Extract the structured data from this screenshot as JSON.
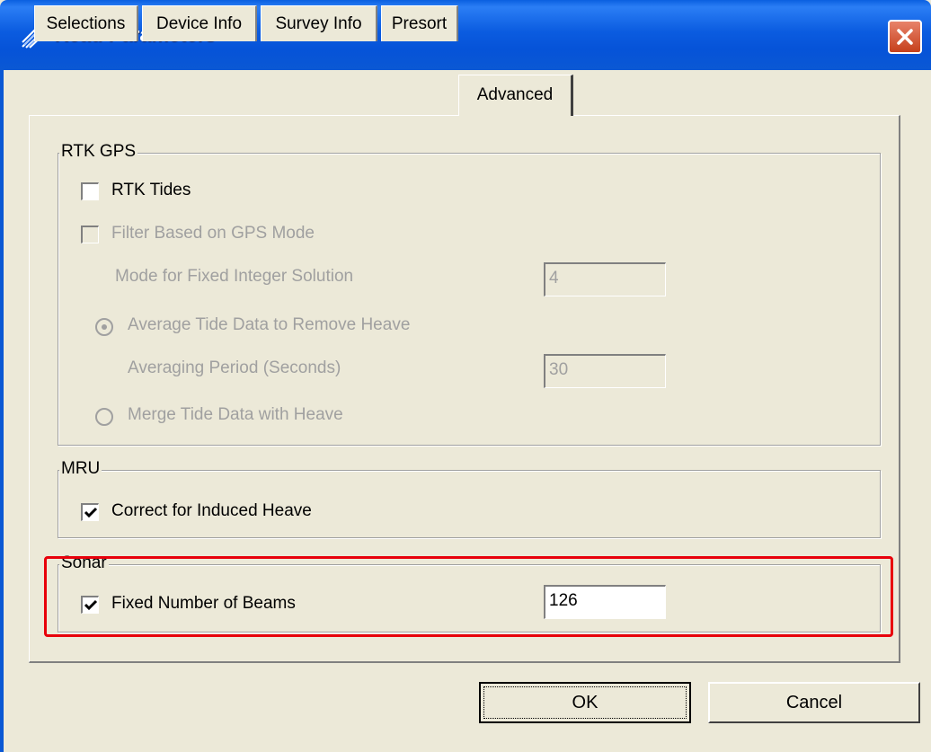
{
  "window": {
    "title": "Read Parameters",
    "icon": "sonar-app-icon"
  },
  "tabs": [
    {
      "label": "Selections",
      "active": false
    },
    {
      "label": "Device Info",
      "active": false
    },
    {
      "label": "Survey Info",
      "active": false
    },
    {
      "label": "Presort",
      "active": false
    },
    {
      "label": "Advanced",
      "active": true
    }
  ],
  "rtk_gps": {
    "title": "RTK GPS",
    "rtk_tides_label": "RTK Tides",
    "rtk_tides_checked": false,
    "filter_label": "Filter Based on GPS Mode",
    "filter_checked": false,
    "filter_enabled": false,
    "mode_label": "Mode for Fixed Integer Solution",
    "mode_value": "4",
    "average_label": "Average Tide Data to Remove Heave",
    "average_selected": true,
    "averaging_period_label": "Averaging Period (Seconds)",
    "averaging_period_value": "30",
    "merge_label": "Merge Tide Data with Heave",
    "merge_selected": false
  },
  "mru": {
    "title": "MRU",
    "induced_heave_label": "Correct for Induced Heave",
    "induced_heave_checked": true
  },
  "sonar": {
    "title": "Sonar",
    "fixed_beams_label": "Fixed Number of Beams",
    "fixed_beams_checked": true,
    "beams_value": "126"
  },
  "buttons": {
    "ok": "OK",
    "cancel": "Cancel"
  },
  "colors": {
    "title_bar": "#0a58d4",
    "dialog_bg": "#ece9d8",
    "highlight": "#e8000b",
    "disabled_text": "#a0a0a0"
  }
}
